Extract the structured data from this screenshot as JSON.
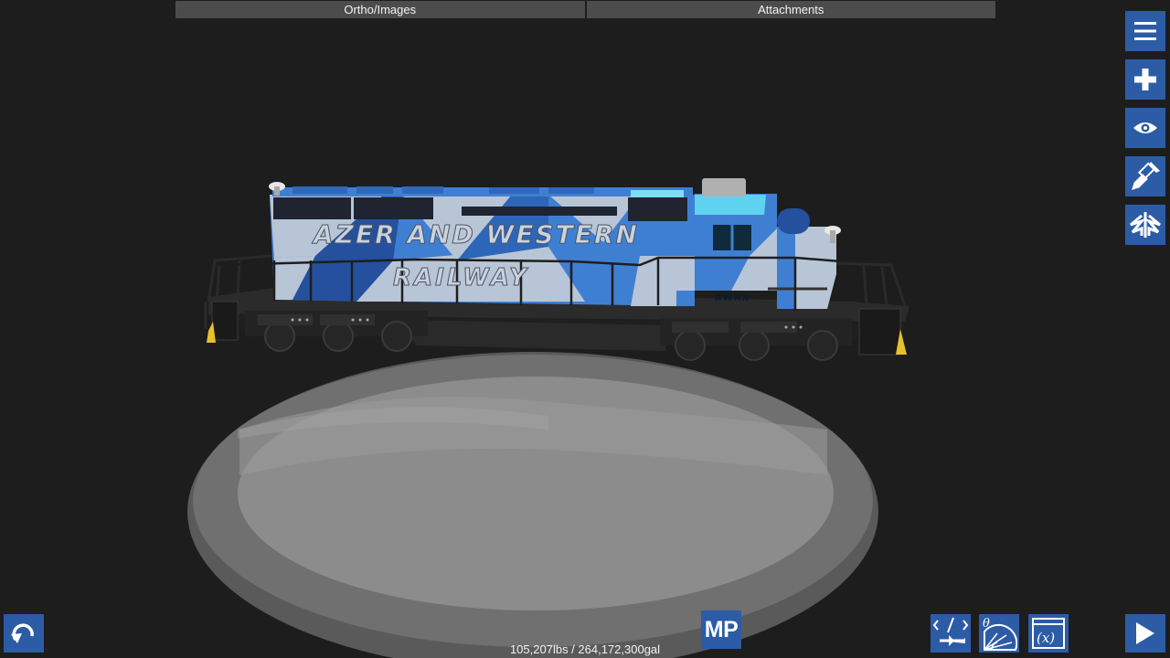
{
  "app": {
    "colors": {
      "background": "#1d1d1d",
      "tab_bg": "#4c4c4c",
      "tool_button": "#2c5ca6",
      "turntable": "#8a8a8a"
    }
  },
  "top_tabs": [
    {
      "label": "Ortho/Images"
    },
    {
      "label": "Attachments"
    }
  ],
  "right_toolbar": {
    "icons": [
      "menu-icon",
      "plus-icon",
      "eye-icon",
      "paintbrush-icon",
      "wings-icon"
    ]
  },
  "bottom_toolbar": {
    "mp_label": "MP",
    "stats": "105,207lbs / 264,172,300gal",
    "icons": [
      "undo-icon",
      "code-plane-icon",
      "theta-protractor-icon",
      "variables-icon",
      "play-icon"
    ]
  },
  "model": {
    "livery_line1": "AZER AND WESTERN",
    "livery_line2": "RAILWAY",
    "reporting_mark": "RWRX",
    "colors": {
      "body_blue": "#3f7fd2",
      "body_light": "#b8c5d6",
      "body_dark": "#24509e",
      "cab_window": "#5fd2f0",
      "frame": "#222222"
    }
  }
}
